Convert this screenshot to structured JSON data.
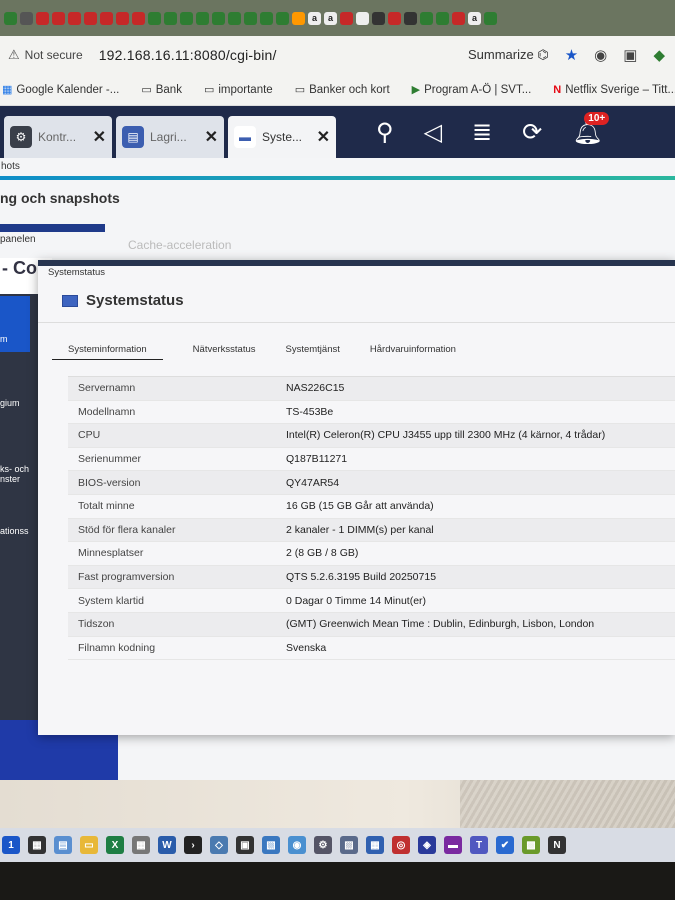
{
  "browser": {
    "address": {
      "security_label": "Not secure",
      "url": "192.168.16.11:8080/cgi-bin/",
      "summarize_label": "Summarize"
    },
    "bookmarks": [
      {
        "label": "Google Kalender -...",
        "icon": "calendar-icon"
      },
      {
        "label": "Bank",
        "icon": "folder-icon"
      },
      {
        "label": "importante",
        "icon": "folder-icon"
      },
      {
        "label": "Banker och kort",
        "icon": "folder-icon"
      },
      {
        "label": "Program A-Ö | SVT...",
        "icon": "play-icon"
      },
      {
        "label": "Netflix Sverige – Titt...",
        "icon": "netflix-icon"
      }
    ]
  },
  "qts": {
    "tabs": [
      {
        "label": "Kontr...",
        "icon": "gear-icon"
      },
      {
        "label": "Lagri...",
        "icon": "storage-icon"
      },
      {
        "label": "Syste...",
        "icon": "monitor-icon"
      }
    ],
    "notification_count": "10+"
  },
  "background_window": {
    "crumb": "hots",
    "title": "ng och snapshots",
    "panel_label": "panelen",
    "faded_tab": "Cache-acceleration",
    "left_heading": "- Co",
    "left_items": [
      "m",
      "gium",
      "ks- och\nnster",
      "ationss"
    ]
  },
  "dialog": {
    "header": "Systemstatus",
    "title": "Systemstatus",
    "tabs": [
      {
        "label": "Systeminformation",
        "active": true
      },
      {
        "label": "Nätverksstatus",
        "active": false
      },
      {
        "label": "Systemtjänst",
        "active": false
      },
      {
        "label": "Hårdvaruinformation",
        "active": false
      }
    ],
    "rows": [
      {
        "key": "Servernamn",
        "value": "NAS226C15"
      },
      {
        "key": "Modellnamn",
        "value": "TS-453Be"
      },
      {
        "key": "CPU",
        "value": "Intel(R) Celeron(R) CPU J3455 upp till 2300 MHz (4 kärnor, 4 trådar)"
      },
      {
        "key": "Serienummer",
        "value": "Q187B11271"
      },
      {
        "key": "BIOS-version",
        "value": "QY47AR54"
      },
      {
        "key": "Totalt minne",
        "value": "16 GB (15 GB Går att använda)"
      },
      {
        "key": "Stöd för flera kanaler",
        "value": "2 kanaler - 1 DIMM(s) per kanal"
      },
      {
        "key": "Minnesplatser",
        "value": "2 (8 GB / 8 GB)"
      },
      {
        "key": "Fast programversion",
        "value": "QTS 5.2.6.3195 Build 20250715"
      },
      {
        "key": "System klartid",
        "value": "0 Dagar 0 Timme 14 Minut(er)"
      },
      {
        "key": "Tidszon",
        "value": "(GMT) Greenwich Mean Time : Dublin, Edinburgh, Lisbon, London"
      },
      {
        "key": "Filnamn kodning",
        "value": "Svenska"
      }
    ]
  }
}
